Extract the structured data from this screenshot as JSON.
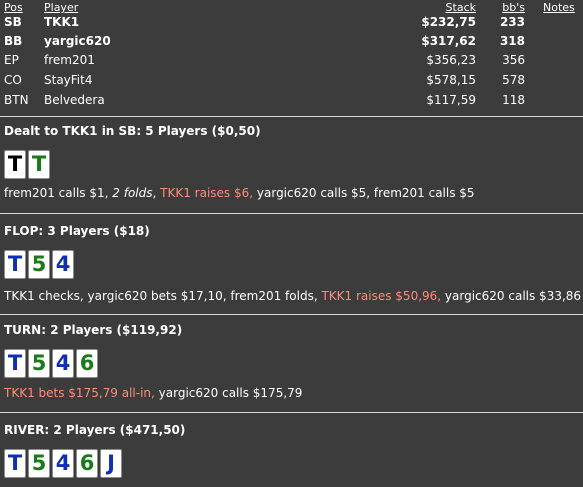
{
  "headers": {
    "pos": "Pos",
    "player": "Player",
    "stack": "Stack",
    "bbs": "bb's",
    "notes": "Notes"
  },
  "players": [
    {
      "pos": "SB",
      "name": "TKK1",
      "stack": "$232,75",
      "bbs": "233"
    },
    {
      "pos": "BB",
      "name": "yargic620",
      "stack": "$317,62",
      "bbs": "318"
    },
    {
      "pos": "EP",
      "name": "frem201",
      "stack": "$356,23",
      "bbs": "356"
    },
    {
      "pos": "CO",
      "name": "StayFit4",
      "stack": "$578,15",
      "bbs": "578"
    },
    {
      "pos": "BTN",
      "name": "Belvedera",
      "stack": "$117,59",
      "bbs": "118"
    }
  ],
  "preflop": {
    "title": "Dealt to TKK1 in SB: 5 Players ($0,50)",
    "cards": [
      {
        "rank": "T",
        "color": "#000000"
      },
      {
        "rank": "T",
        "color": "#1a7a1a"
      }
    ],
    "actions": [
      {
        "text": "frem201 calls $1, ",
        "style": "normal"
      },
      {
        "text": "2 folds",
        "style": "italic"
      },
      {
        "text": ", ",
        "style": "normal"
      },
      {
        "text": "TKK1 raises $6, ",
        "style": "hero"
      },
      {
        "text": "yargic620 calls $5, frem201 calls $5",
        "style": "normal"
      }
    ]
  },
  "flop": {
    "title": "FLOP: 3 Players ($18)",
    "cards": [
      {
        "rank": "T",
        "color": "#1030b0"
      },
      {
        "rank": "5",
        "color": "#1a7a1a"
      },
      {
        "rank": "4",
        "color": "#1030b0"
      }
    ],
    "actions": [
      {
        "text": "TKK1 checks, yargic620 bets $17,10, frem201 folds, ",
        "style": "normal"
      },
      {
        "text": "TKK1 raises $50,96, ",
        "style": "hero"
      },
      {
        "text": "yargic620 calls $33,86",
        "style": "normal"
      }
    ]
  },
  "turn": {
    "title": "TURN: 2 Players ($119,92)",
    "cards": [
      {
        "rank": "T",
        "color": "#1030b0"
      },
      {
        "rank": "5",
        "color": "#1a7a1a"
      },
      {
        "rank": "4",
        "color": "#1030b0"
      },
      {
        "rank": "6",
        "color": "#1a7a1a"
      }
    ],
    "actions": [
      {
        "text": "TKK1 bets $175,79 all-in, ",
        "style": "hero"
      },
      {
        "text": "yargic620 calls $175,79",
        "style": "normal"
      }
    ]
  },
  "river": {
    "title": "RIVER: 2 Players ($471,50)",
    "cards": [
      {
        "rank": "T",
        "color": "#1030b0"
      },
      {
        "rank": "5",
        "color": "#1a7a1a"
      },
      {
        "rank": "4",
        "color": "#1030b0"
      },
      {
        "rank": "6",
        "color": "#1a7a1a"
      },
      {
        "rank": "J",
        "color": "#1030b0"
      }
    ]
  }
}
